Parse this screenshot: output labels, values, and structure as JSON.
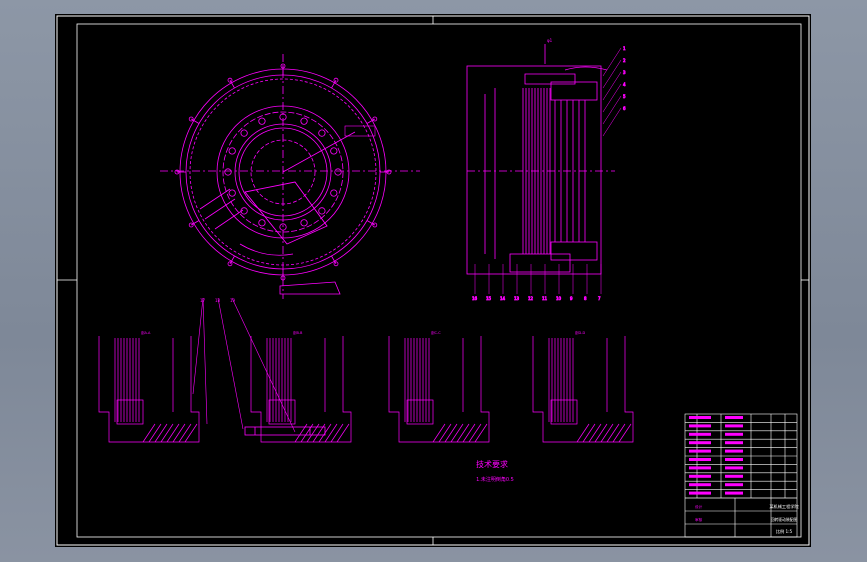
{
  "drawing": {
    "section_labels": [
      "剖A-A",
      "剖B-B",
      "剖C-C",
      "剖D-D"
    ],
    "tech_title": "技术要求",
    "tech_note": "1.未注明倒角0.5",
    "callouts_right": [
      "1",
      "2",
      "3",
      "4",
      "5",
      "6"
    ],
    "callouts_bottom": [
      "16",
      "15",
      "14",
      "13",
      "12",
      "11",
      "10",
      "9",
      "8",
      "7"
    ],
    "callouts_mid": [
      "17",
      "18",
      "19"
    ],
    "dim_top": "φ1"
  },
  "title_block": {
    "company": "某机械工程学院",
    "drawing_name": "回转驱动装配图",
    "scale": "比例 1:5",
    "designer": "设计",
    "checker": "审核"
  },
  "colors": {
    "background": "#000000",
    "line": "#ff00ff",
    "frame": "#ffffff",
    "workspace": "#8d97a6"
  }
}
